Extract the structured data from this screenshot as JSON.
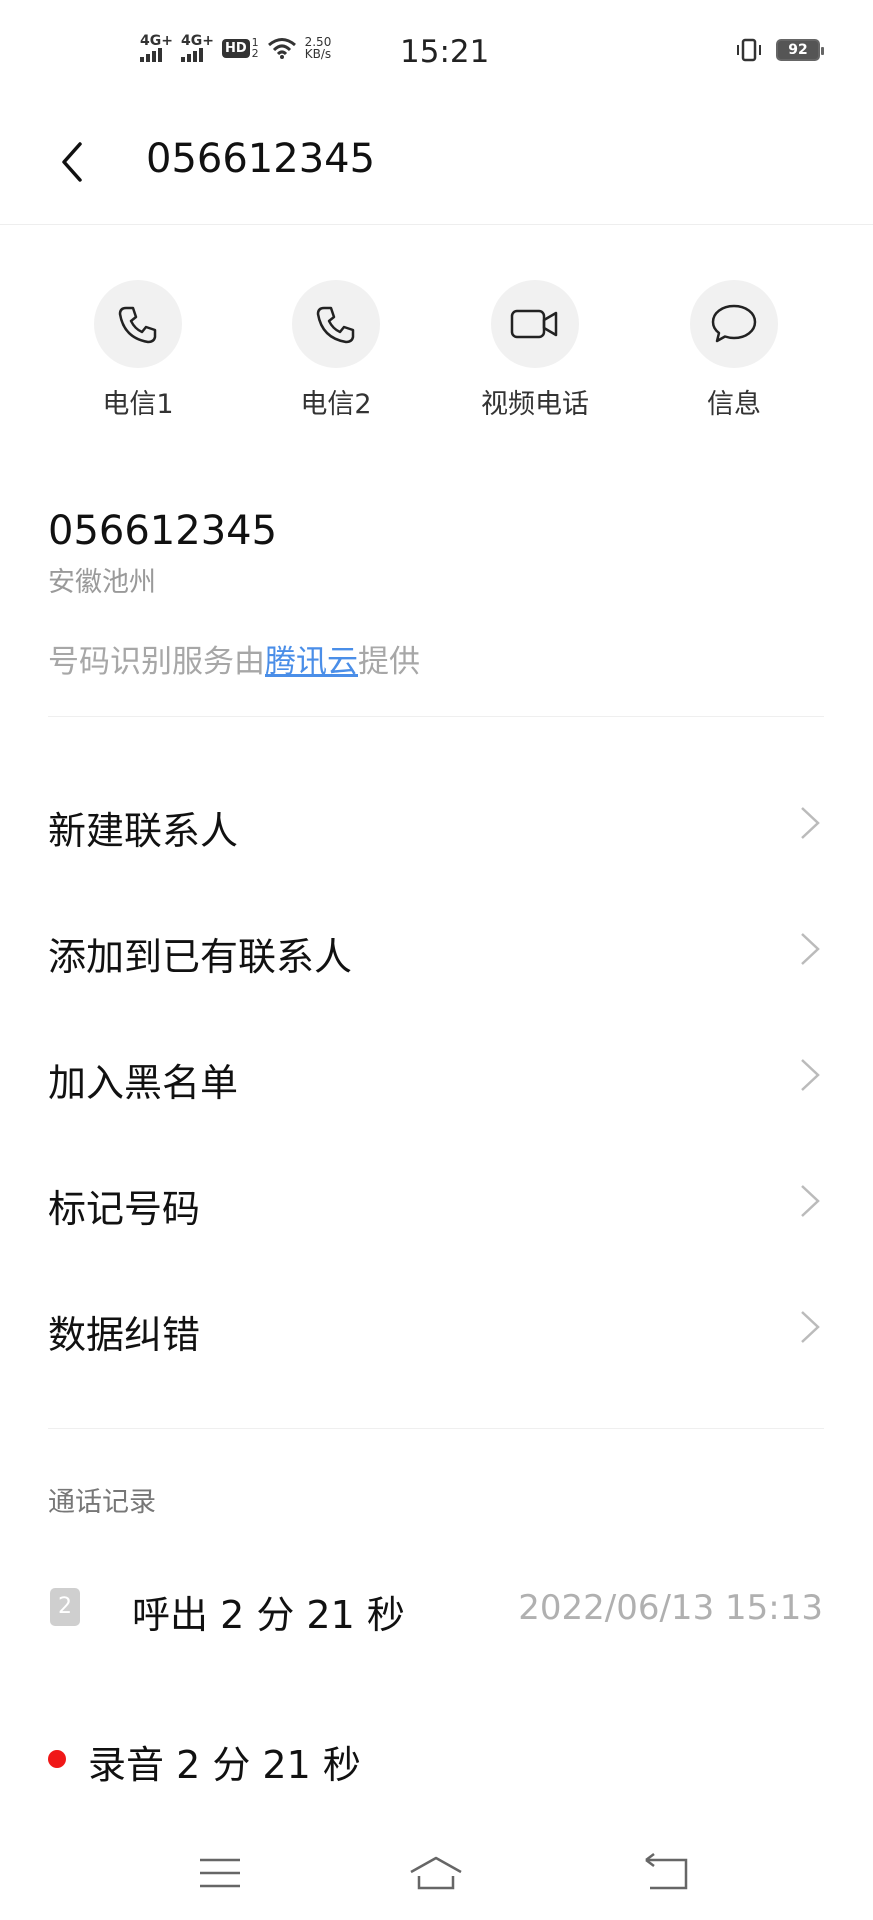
{
  "status_bar": {
    "sim1_label": "4G+",
    "sim2_label": "4G+",
    "hd_label": "HD",
    "hd_sims": [
      "1",
      "2"
    ],
    "speed_value": "2.50",
    "speed_unit": "KB/s",
    "time": "15:21",
    "battery": "92",
    "icons": [
      "signal-icon",
      "hd-icon",
      "wifi-icon",
      "vibrate-icon",
      "battery-icon"
    ]
  },
  "header": {
    "title": "056612345",
    "back_icon": "chevron-left-icon"
  },
  "actions": [
    {
      "label": "电信1",
      "icon": "phone-icon"
    },
    {
      "label": "电信2",
      "icon": "phone-icon"
    },
    {
      "label": "视频电话",
      "icon": "video-camera-icon"
    },
    {
      "label": "信息",
      "icon": "chat-bubble-icon"
    }
  ],
  "number_info": {
    "number": "056612345",
    "location": "安徽池州",
    "provider_prefix": "号码识别服务由",
    "provider_link": "腾讯云",
    "provider_suffix": "提供"
  },
  "menu": [
    {
      "label": "新建联系人"
    },
    {
      "label": "添加到已有联系人"
    },
    {
      "label": "加入黑名单"
    },
    {
      "label": "标记号码"
    },
    {
      "label": "数据纠错"
    }
  ],
  "call_log": {
    "title": "通话记录",
    "entries": [
      {
        "sim": "2",
        "text": "呼出 2 分 21 秒",
        "time": "2022/06/13 15:13"
      }
    ],
    "recording": {
      "text": "录音 2 分 21 秒",
      "color": "#f01818"
    }
  },
  "colors": {
    "accent_link": "#4a8ee8",
    "record_dot": "#f01818",
    "icon_bg": "#f1f1f1"
  },
  "nav_bar": {
    "icons": [
      "menu-icon",
      "home-icon",
      "back-icon"
    ]
  }
}
